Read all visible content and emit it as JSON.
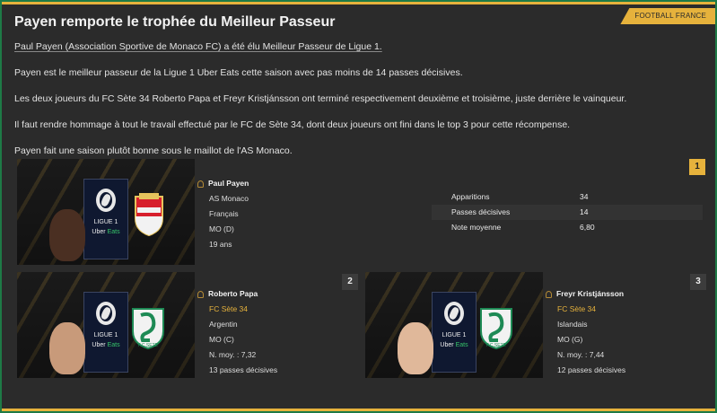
{
  "tag": "FOOTBALL FRANCE",
  "title": "Payen remporte le trophée du Meilleur Passeur",
  "article": {
    "p1": "Paul Payen (Association Sportive de Monaco FC) a été élu Meilleur Passeur de Ligue 1.",
    "p2": "Payen est le meilleur passeur de la Ligue 1 Uber Eats cette saison avec pas moins de 14 passes décisives.",
    "p3": "Les deux joueurs du FC Sète 34 Roberto Papa et Freyr Kristjánsson ont terminé respectivement deuxième et troisième, juste derrière le vainqueur.",
    "p4": "Il faut rendre hommage à tout le travail effectué par le FC de Sète 34, dont deux joueurs ont fini dans le top 3 pour cette récompense.",
    "p5": "Payen fait une saison plutôt bonne sous le maillot de l'AS Monaco."
  },
  "league_logo": {
    "line1": "LIGUE 1",
    "line2a": "Uber",
    "line2b": "Eats"
  },
  "winner": {
    "rank": "1",
    "name": "Paul Payen",
    "club": "AS Monaco",
    "nationality": "Français",
    "position": "MO (D)",
    "age": "19 ans",
    "stats": [
      {
        "label": "Apparitions",
        "value": "34"
      },
      {
        "label": "Passes décisives",
        "value": "14"
      },
      {
        "label": "Note moyenne",
        "value": "6,80"
      }
    ]
  },
  "second": {
    "rank": "2",
    "name": "Roberto Papa",
    "club": "FC Sète 34",
    "nationality": "Argentin",
    "position": "MO (C)",
    "rating": "N. moy. : 7,32",
    "assists": "13 passes décisives"
  },
  "third": {
    "rank": "3",
    "name": "Freyr Kristjánsson",
    "club": "FC Sète 34",
    "nationality": "Islandais",
    "position": "MO (G)",
    "rating": "N. moy. : 7,44",
    "assists": "12 passes décisives"
  },
  "colors": {
    "accent": "#e6b23c",
    "background": "#2b2b2b",
    "frame": "#1e7a46",
    "monaco_red": "#d71f2c",
    "sete_green": "#1e8a55"
  }
}
